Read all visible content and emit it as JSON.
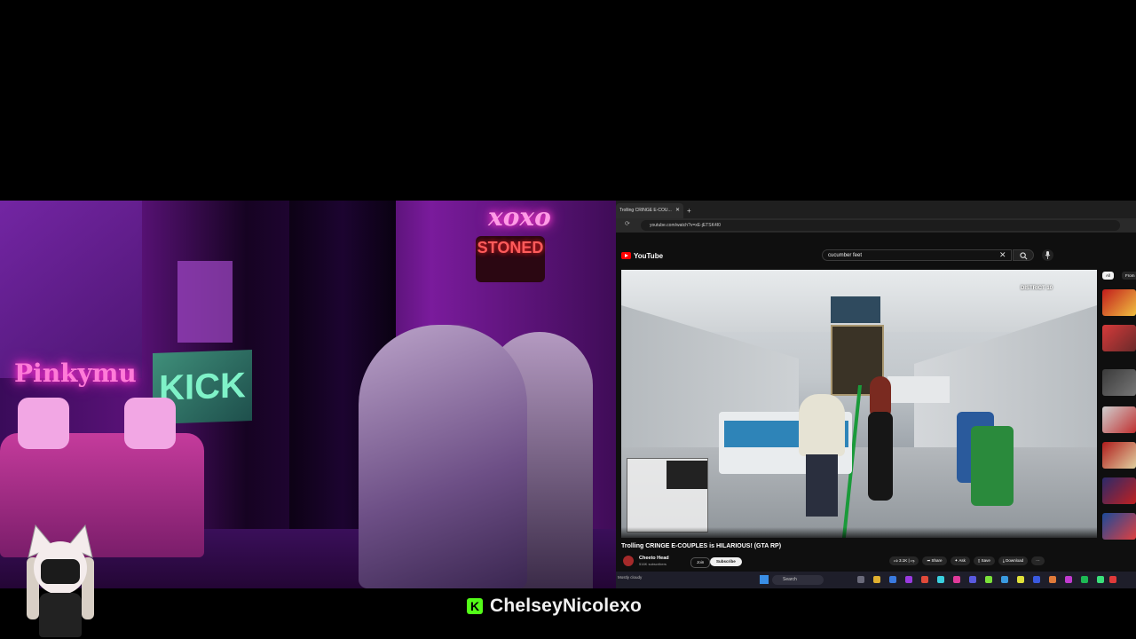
{
  "browser": {
    "tab": {
      "title": "Trolling CRINGE E-COU..."
    },
    "address_url": "youtube.com/watch?v=xE-jETSK4I0",
    "youtube": {
      "logo_text": "YouTube",
      "search_value": "cucumber feet",
      "filter_chips": [
        "All",
        "From"
      ]
    },
    "video": {
      "hud_district": "DISTRICT 10",
      "title": "Trolling CRINGE E-COUPLES is HILARIOUS! (GTA RP)",
      "channel_name": "Cheeto Head",
      "channel_subscribers": "516K subscribers",
      "join_label": "Join",
      "subscribe_label": "Subscribe",
      "like_count": "3.1K",
      "share_label": "Share",
      "ask_label": "Ask",
      "save_label": "Save",
      "download_label": "Download"
    },
    "taskbar": {
      "search_label": "Search",
      "weather_text": "Mostly cloudy"
    }
  },
  "webcam": {
    "neon_left": "Pinkymu",
    "neon_xoxo": "xoxo",
    "neon_stoned": "STONED",
    "kick_sign": "KICK"
  },
  "streamer": {
    "username": "ChelseyNicolexo"
  },
  "colors": {
    "youtube_red": "#ff0000",
    "kick_green": "#53fc18",
    "neon_pink": "#ff2ecb"
  }
}
